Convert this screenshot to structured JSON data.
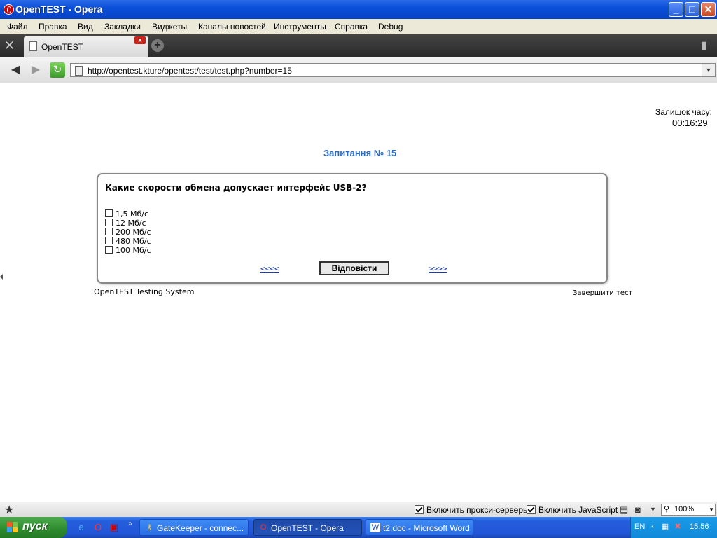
{
  "window": {
    "title": "OpenTEST - Opera",
    "controls": {
      "minimize": "_",
      "maximize": "□",
      "close": "✕"
    }
  },
  "menu": {
    "items": [
      "Файл",
      "Правка",
      "Вид",
      "Закладки",
      "Виджеты",
      "Каналы новостей",
      "Инструменты",
      "Справка",
      "Debug"
    ]
  },
  "tabs": [
    {
      "label": "OpenTEST"
    }
  ],
  "address": {
    "url": "http://opentest.kture/opentest/test/test.php?number=15"
  },
  "timer": {
    "label": "Залишок часу:",
    "value": "00:16:29"
  },
  "question": {
    "heading": "Запитання № 15",
    "text": "Какие скорости обмена допускает интерфейс USB-2?",
    "options": [
      "1,5 Мб/с",
      "12 Мб/с",
      "200 Мб/с",
      "480 Мб/с",
      "100 Мб/с"
    ],
    "prev_label": "<<<<",
    "next_label": ">>>>",
    "answer_label": "Відповісти"
  },
  "footer": {
    "system_name": "OpenTEST Testing System",
    "finish_label": "Завершити тест"
  },
  "statusbar": {
    "proxy_label": "Включить прокси-серверы",
    "js_label": "Включить JavaScript",
    "zoom": "100%"
  },
  "taskbar": {
    "start_label": "пуск",
    "tasks": [
      {
        "label": "GateKeeper - connec...",
        "active": false
      },
      {
        "label": "OpenTEST - Opera",
        "active": true
      },
      {
        "label": "t2.doc - Microsoft Word",
        "active": false
      }
    ],
    "language": "EN",
    "clock": "15:56"
  },
  "colors": {
    "heading_blue": "#2a6bc4",
    "link_blue": "#1a3fb8",
    "xp_blue": "#245edb",
    "start_green": "#2e8a2e"
  }
}
